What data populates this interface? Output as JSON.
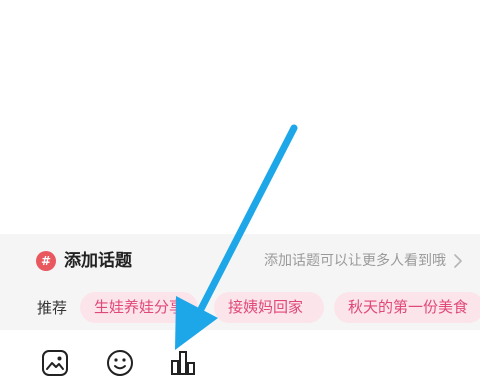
{
  "topic": {
    "badge_symbol": "#",
    "title": "添加话题",
    "hint": "添加话题可以让更多人看到哦"
  },
  "recommend": {
    "label": "推荐",
    "chips": [
      "生娃养娃分享",
      "接姨妈回家",
      "秋天的第一份美食"
    ]
  },
  "toolbar": {
    "icons": [
      "image-icon",
      "emoji-icon",
      "chart-icon"
    ]
  },
  "colors": {
    "accent_red": "#e8585e",
    "chip_bg": "#fbe4ea",
    "chip_text": "#e0487a",
    "arrow_blue": "#1ea7e8",
    "panel_bg": "#f5f5f5"
  }
}
